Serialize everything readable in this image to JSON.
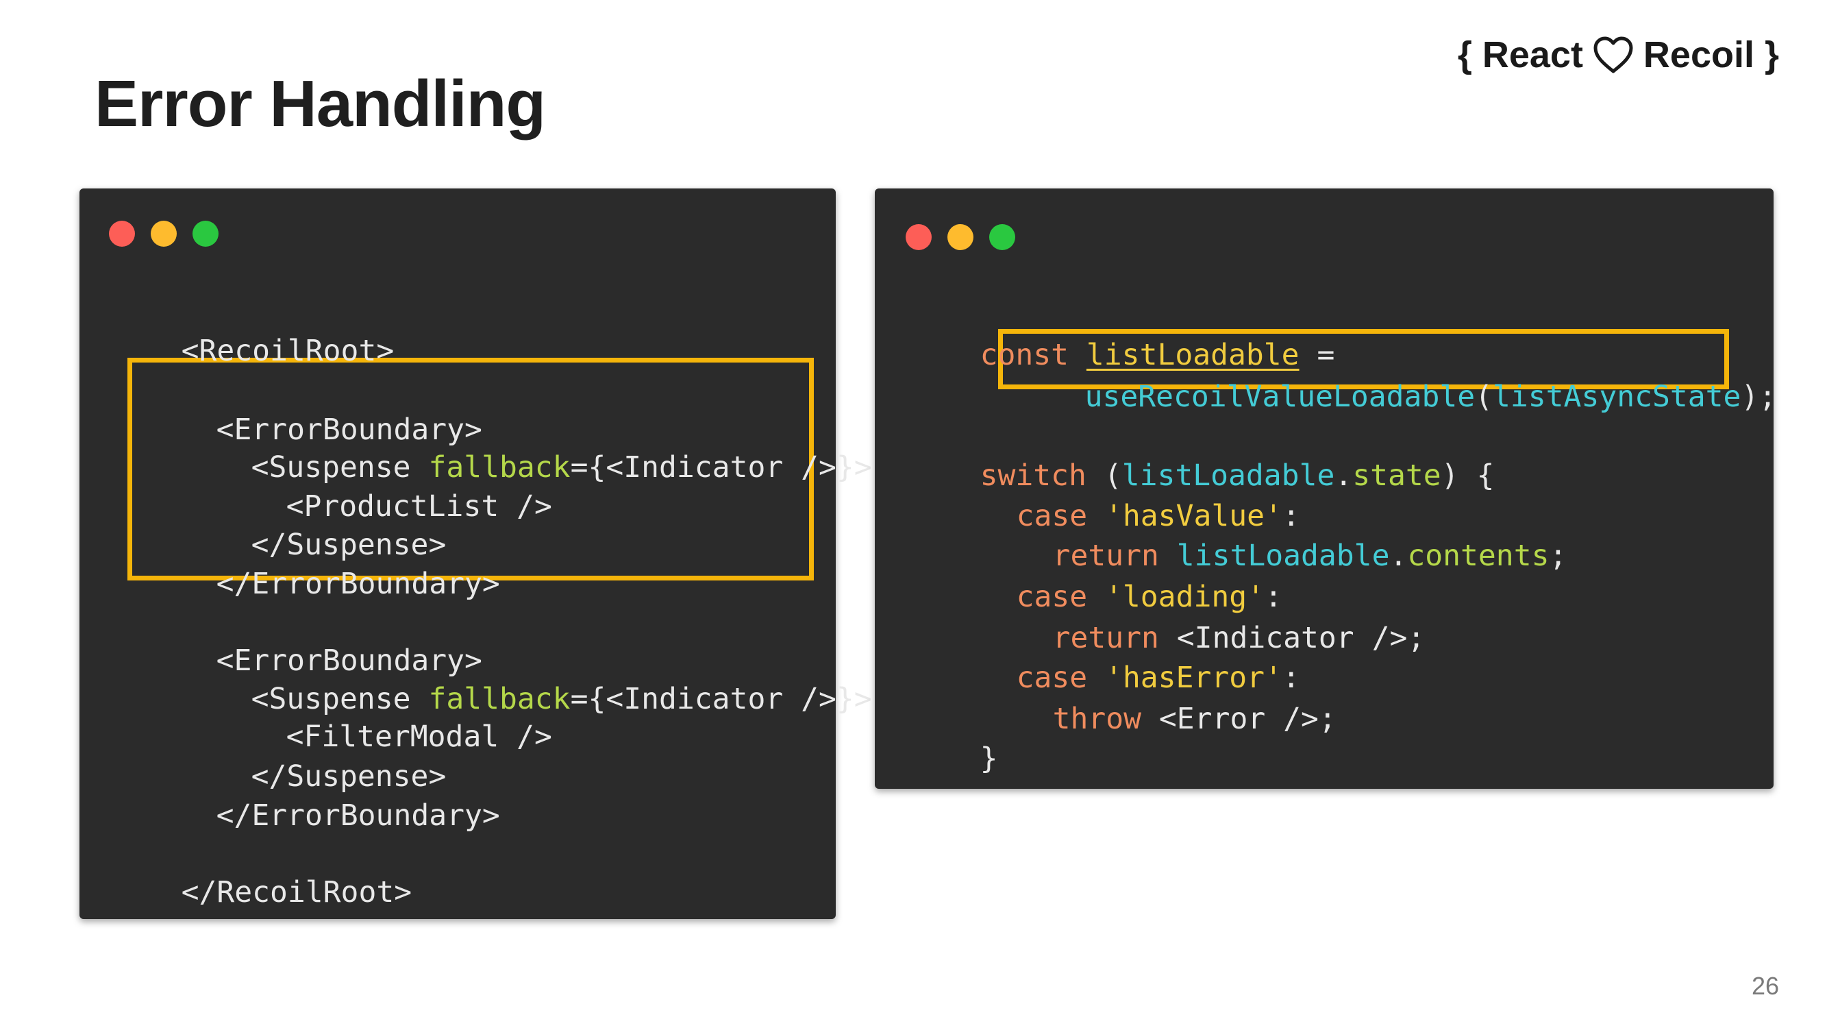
{
  "slide": {
    "title": "Error Handling",
    "brand_open": "{ React",
    "brand_close": "Recoil }",
    "page_number": "26"
  },
  "icons": {
    "brand_heart": "heart-outline-icon"
  },
  "colors": {
    "window_bg": "#2b2b2b",
    "highlight": "#f5b50a",
    "keyword": "#f08c5e",
    "identifier": "#44ccd6",
    "string": "#f1cc3f",
    "attribute": "#b5d84a",
    "traffic_red": "#fd5e57",
    "traffic_yellow": "#febb2e",
    "traffic_green": "#2ac840"
  },
  "left_code": {
    "recoil_root_open": "<RecoilRoot>",
    "eb1_open": "<ErrorBoundary>",
    "eb1_suspense_open_a": "<Suspense ",
    "eb1_suspense_attr": "fallback",
    "eb1_suspense_open_b": "={<Indicator />}>",
    "eb1_child": "<ProductList />",
    "eb1_suspense_close": "</Suspense>",
    "eb1_close": "</ErrorBoundary>",
    "eb2_open": "<ErrorBoundary>",
    "eb2_suspense_open_a": "<Suspense ",
    "eb2_suspense_attr": "fallback",
    "eb2_suspense_open_b": "={<Indicator />}>",
    "eb2_child": "<FilterModal />",
    "eb2_suspense_close": "</Suspense>",
    "eb2_close": "</ErrorBoundary>",
    "recoil_root_close": "</RecoilRoot>"
  },
  "right_code": {
    "l1_kw": "const",
    "l1_var": "listLoadable",
    "l1_eq": " =",
    "l2_fn": "useRecoilValueLoadable",
    "l2_paren_open": "(",
    "l2_arg": "listAsyncState",
    "l2_end": ");",
    "l3_kw": "switch",
    "l3_paren": " (",
    "l3_var": "listLoadable",
    "l3_dot": ".",
    "l3_prop": "state",
    "l3_end": ") {",
    "l4_kw": "case",
    "l4_str": "'hasValue'",
    "l4_colon": ":",
    "l5_kw": "return",
    "l5_var": "listLoadable",
    "l5_dot": ".",
    "l5_prop": "contents",
    "l5_end": ";",
    "l6_kw": "case",
    "l6_str": "'loading'",
    "l6_colon": ":",
    "l7_kw": "return",
    "l7_rest": " <Indicator />;",
    "l8_kw": "case",
    "l8_str": "'hasError'",
    "l8_colon": ":",
    "l9_kw": "throw",
    "l9_rest": " <Error />;",
    "l10_close": "}"
  }
}
